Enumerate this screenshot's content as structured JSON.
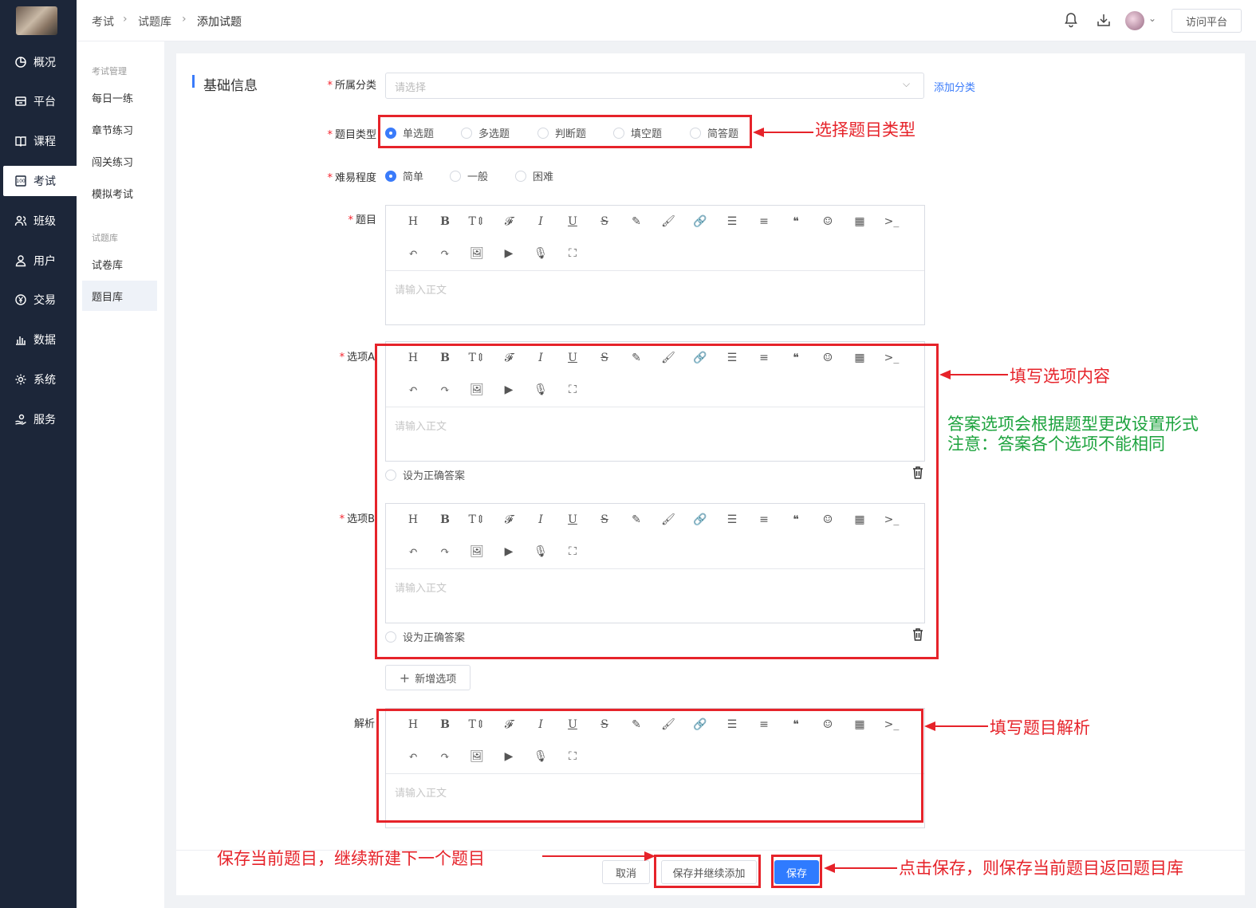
{
  "sidebar": {
    "items": [
      {
        "label": "概况",
        "icon": "pie-chart-icon"
      },
      {
        "label": "平台",
        "icon": "platform-icon"
      },
      {
        "label": "课程",
        "icon": "book-icon"
      },
      {
        "label": "考试",
        "icon": "exam-icon"
      },
      {
        "label": "班级",
        "icon": "class-icon"
      },
      {
        "label": "用户",
        "icon": "user-icon"
      },
      {
        "label": "交易",
        "icon": "yen-icon"
      },
      {
        "label": "数据",
        "icon": "bar-chart-icon"
      },
      {
        "label": "系统",
        "icon": "gear-icon"
      },
      {
        "label": "服务",
        "icon": "service-icon"
      }
    ],
    "active": "考试"
  },
  "subnav": {
    "group1": "考试管理",
    "group1_items": [
      "每日一练",
      "章节练习",
      "闯关练习",
      "模拟考试"
    ],
    "group2": "试题库",
    "group2_items": [
      "试卷库",
      "题目库"
    ],
    "active": "题目库"
  },
  "breadcrumb": [
    "考试",
    "试题库",
    "添加试题"
  ],
  "topbar": {
    "visit_label": "访问平台"
  },
  "section_title": "基础信息",
  "form": {
    "category_label": "所属分类",
    "category_placeholder": "请选择",
    "add_category": "添加分类",
    "type_label": "题目类型",
    "types": [
      "单选题",
      "多选题",
      "判断题",
      "填空题",
      "简答题"
    ],
    "type_selected": "单选题",
    "difficulty_label": "难易程度",
    "difficulties": [
      "简单",
      "一般",
      "困难"
    ],
    "difficulty_selected": "简单",
    "question_label": "题目",
    "option_a_label": "选项A",
    "option_b_label": "选项B",
    "analysis_label": "解析",
    "editor_placeholder": "请输入正文",
    "set_correct": "设为正确答案",
    "add_option": "新增选项"
  },
  "toolbar_icons_row1": [
    "H",
    "B",
    "T⇕",
    "𝓕",
    "I",
    "U",
    "S",
    "✎",
    "🖌",
    "🔗",
    "☰",
    "≡",
    "❝",
    "☺",
    "▦",
    ">_"
  ],
  "toolbar_icons_row2": [
    "↶",
    "↷",
    "🖼",
    "▶",
    "🎙",
    "⛶"
  ],
  "buttons": {
    "cancel": "取消",
    "save_continue": "保存并继续添加",
    "save": "保存"
  },
  "annotations": {
    "select_type": "选择题目类型",
    "fill_options": "填写选项内容",
    "note_line1": "答案选项会根据题型更改设置形式",
    "note_line2": "注意：答案各个选项不能相同",
    "fill_analysis": "填写题目解析",
    "save_continue_note": "保存当前题目，继续新建下一个题目",
    "save_note": "点击保存，则保存当前题目返回题目库"
  },
  "colors": {
    "accent": "#2f7bff",
    "sidebar": "#1c2639",
    "highlight": "#e6232a",
    "note_green": "#1da33e"
  }
}
